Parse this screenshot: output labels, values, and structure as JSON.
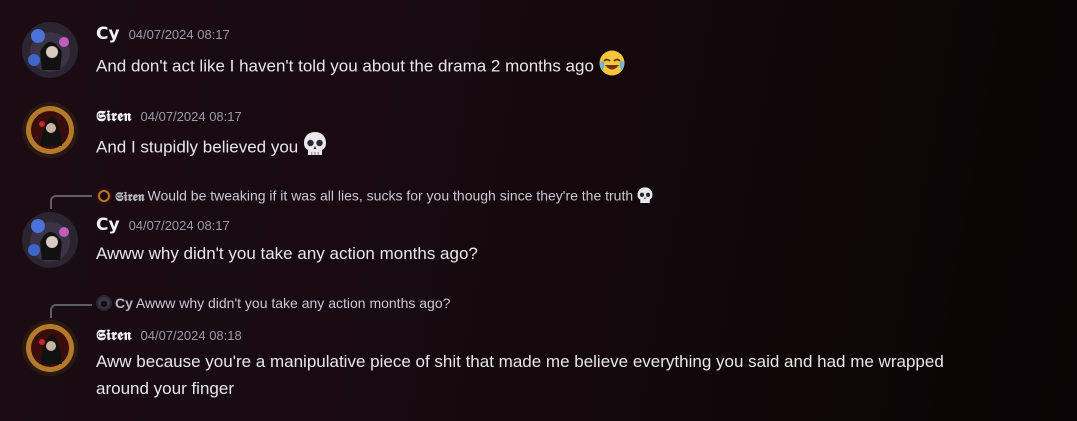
{
  "messages": [
    {
      "author": "Cy",
      "timestamp": "04/07/2024 08:17",
      "text": "And don't act like I haven't told you about the drama 2 months ago",
      "emoji": "joy-emoji"
    },
    {
      "author": "𝕾𝖎𝖗𝖊𝖓",
      "timestamp": "04/07/2024 08:17",
      "text": "And I stupidly believed you",
      "emoji": "skull-emoji"
    },
    {
      "reply_to": {
        "author": "𝕾𝖎𝖗𝖊𝖓",
        "text": "Would be tweaking if it was all lies, sucks for you though since they're the truth",
        "emoji": "skull-emoji"
      },
      "author": "Cy",
      "timestamp": "04/07/2024 08:17",
      "text": "Awww why didn't you take any action months ago?"
    },
    {
      "reply_to": {
        "author": "Cy",
        "text": "Awww why didn't you take any action months ago?"
      },
      "author": "𝕾𝖎𝖗𝖊𝖓",
      "timestamp": "04/07/2024 08:18",
      "text": "Aww because you're a manipulative piece of shit that made me believe everything you said and had me wrapped around your finger"
    }
  ],
  "colors": {
    "text": "#e6e7e9",
    "username": "#f2f3f5",
    "timestamp": "#9a9ca3",
    "reply_line": "#5c5f66"
  }
}
